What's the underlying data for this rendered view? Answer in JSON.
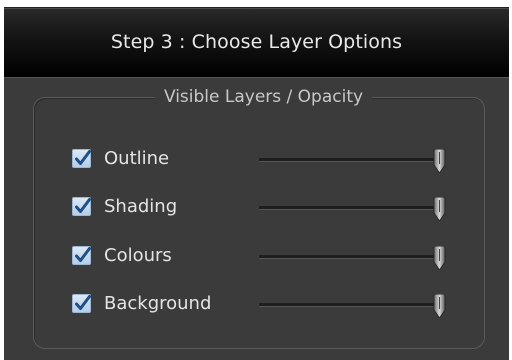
{
  "title": "Step 3 : Choose Layer Options",
  "group": {
    "legend": "Visible Layers / Opacity"
  },
  "layers": [
    {
      "label": "Outline",
      "checked": true,
      "opacity": 1.0
    },
    {
      "label": "Shading",
      "checked": true,
      "opacity": 1.0
    },
    {
      "label": "Colours",
      "checked": true,
      "opacity": 1.0
    },
    {
      "label": "Background",
      "checked": true,
      "opacity": 1.0
    }
  ],
  "icons": {
    "checkmark": "checkmark-icon",
    "slider_thumb": "slider-thumb"
  },
  "colors": {
    "panel_bg": "#3b3b3b",
    "checkbox_fill": "#c9dcef",
    "check_mark": "#1f4f86"
  }
}
